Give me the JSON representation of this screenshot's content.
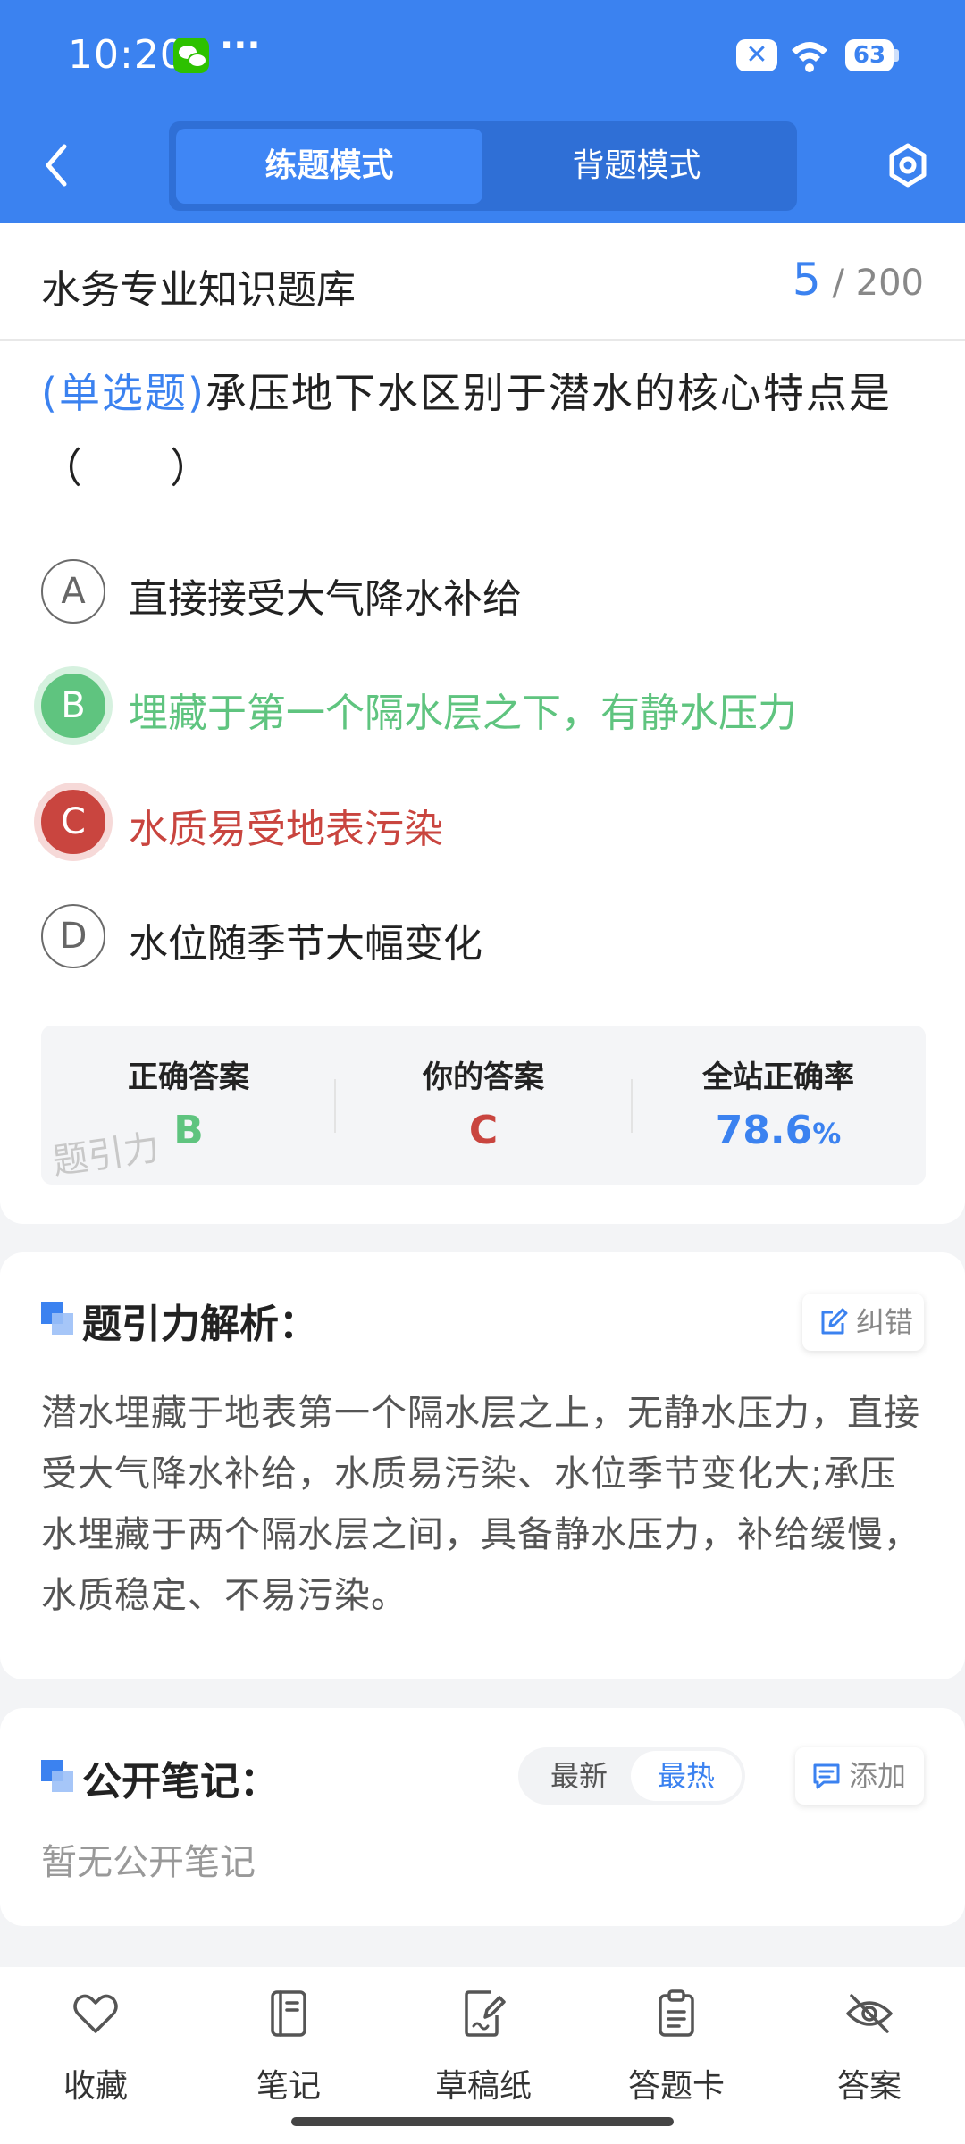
{
  "status_bar": {
    "time": "10:20",
    "dots": "···",
    "battery": "63",
    "x_badge": "✕"
  },
  "header": {
    "tabs": [
      {
        "label": "练题模式",
        "active": true
      },
      {
        "label": "背题模式",
        "active": false
      }
    ],
    "accent_color": "#3b82f0"
  },
  "bank": {
    "title": "水务专业知识题库",
    "current": "5",
    "total": "/ 200"
  },
  "question": {
    "type": "(单选题)",
    "text": "承压地下水区别于潜水的核心特点是（　　）",
    "options": [
      {
        "letter": "A",
        "text": "直接接受大气降水补给",
        "state": "normal"
      },
      {
        "letter": "B",
        "text": "埋藏于第一个隔水层之下，有静水压力",
        "state": "correct"
      },
      {
        "letter": "C",
        "text": "水质易受地表污染",
        "state": "wrong"
      },
      {
        "letter": "D",
        "text": "水位随季节大幅变化",
        "state": "normal"
      }
    ]
  },
  "result": {
    "correct_label": "正确答案",
    "correct_value": "B",
    "yours_label": "你的答案",
    "yours_value": "C",
    "rate_label": "全站正确率",
    "rate_value": "78.6",
    "rate_unit": "%",
    "watermark": "题引力"
  },
  "analysis": {
    "title": "题引力解析：",
    "report_label": "纠错",
    "text": "潜水埋藏于地表第一个隔水层之上，无静水压力，直接受大气降水补给，水质易污染、水位季节变化大;承压水埋藏于两个隔水层之间，具备静水压力，补给缓慢，水质稳定、不易污染。"
  },
  "notes": {
    "title": "公开笔记：",
    "sort_latest": "最新",
    "sort_hot": "最热",
    "add_label": "添加",
    "empty": "暂无公开笔记"
  },
  "bottom_nav": [
    {
      "label": "收藏",
      "icon": "heart-icon"
    },
    {
      "label": "笔记",
      "icon": "notebook-icon"
    },
    {
      "label": "草稿纸",
      "icon": "draft-icon"
    },
    {
      "label": "答题卡",
      "icon": "clipboard-icon"
    },
    {
      "label": "答案",
      "icon": "eye-off-icon"
    }
  ],
  "colors": {
    "correct": "#5fc47f",
    "wrong": "#c9453f",
    "primary": "#3b82f0"
  }
}
